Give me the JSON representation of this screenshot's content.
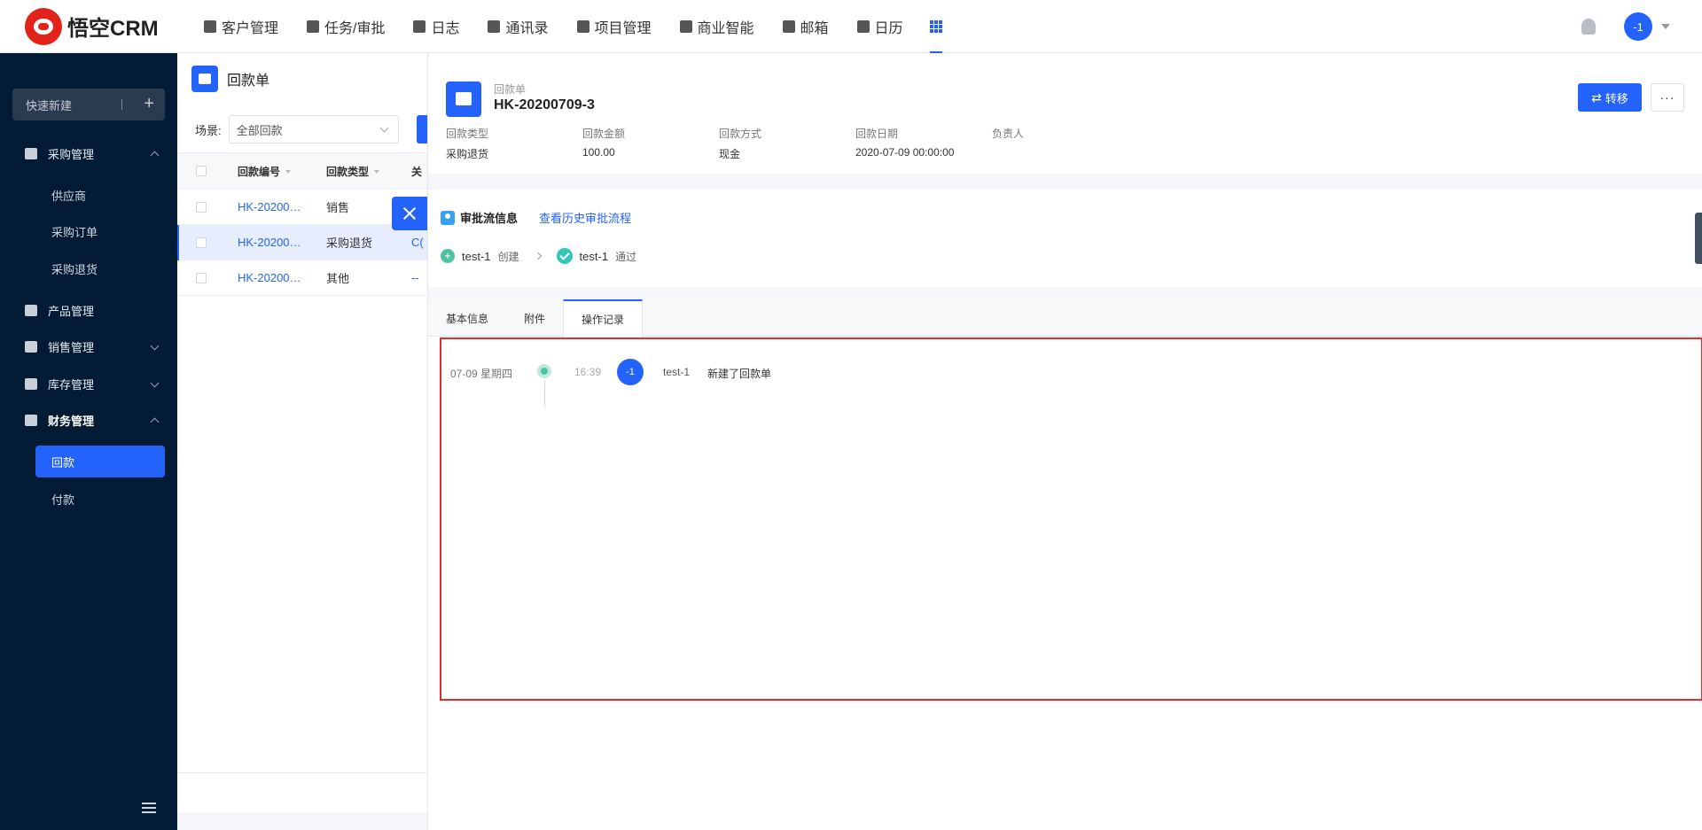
{
  "brand": {
    "name": "悟空CRM"
  },
  "nav": {
    "items": [
      {
        "label": "客户管理",
        "icon": "building-icon"
      },
      {
        "label": "任务/审批",
        "icon": "briefcase-icon"
      },
      {
        "label": "日志",
        "icon": "notebook-icon"
      },
      {
        "label": "通讯录",
        "icon": "phone-book-icon"
      },
      {
        "label": "项目管理",
        "icon": "board-icon"
      },
      {
        "label": "商业智能",
        "icon": "bi-icon"
      },
      {
        "label": "邮箱",
        "icon": "mail-icon"
      },
      {
        "label": "日历",
        "icon": "calendar-icon"
      }
    ],
    "apps_icon": "apps-grid-icon"
  },
  "user": {
    "avatar_text": "-1"
  },
  "sidebar": {
    "quick_create": "快速新建",
    "groups": [
      {
        "label": "采购管理",
        "expanded": true,
        "children": [
          "供应商",
          "采购订单",
          "采购退货"
        ]
      },
      {
        "label": "产品管理",
        "expanded": false,
        "children": []
      },
      {
        "label": "销售管理",
        "expanded": false,
        "children": []
      },
      {
        "label": "库存管理",
        "expanded": false,
        "children": []
      },
      {
        "label": "财务管理",
        "expanded": true,
        "children": [
          "回款",
          "付款"
        ]
      }
    ],
    "active_item": "回款"
  },
  "list": {
    "title": "回款单",
    "scene_label": "场景:",
    "scene_value": "全部回款",
    "columns": [
      "回款编号",
      "回款类型",
      "关"
    ],
    "rows": [
      {
        "no": "HK-20200…",
        "type": "销售",
        "rel": ""
      },
      {
        "no": "HK-20200…",
        "type": "采购退货",
        "rel": "C("
      },
      {
        "no": "HK-20200…",
        "type": "其他",
        "rel": "--"
      }
    ]
  },
  "detail": {
    "record_type": "回款单",
    "record_no": "HK-20200709-3",
    "transfer_label": "转移",
    "more_label": "···",
    "fields": [
      {
        "label": "回款类型",
        "value": "采购退货"
      },
      {
        "label": "回款金额",
        "value": "100.00"
      },
      {
        "label": "回款方式",
        "value": "现金"
      },
      {
        "label": "回款日期",
        "value": "2020-07-09 00:00:00"
      },
      {
        "label": "负责人",
        "value": ""
      }
    ],
    "approval": {
      "title": "审批流信息",
      "history_link": "查看历史审批流程",
      "steps": [
        {
          "user": "test-1",
          "action": "创建"
        },
        {
          "user": "test-1",
          "action": "通过"
        }
      ]
    },
    "tabs": [
      "基本信息",
      "附件",
      "操作记录"
    ],
    "active_tab": "操作记录",
    "log": {
      "date": "07-09 星期四",
      "time": "16:39",
      "avatar_text": "-1",
      "user": "test-1",
      "text": "新建了回款单"
    }
  }
}
